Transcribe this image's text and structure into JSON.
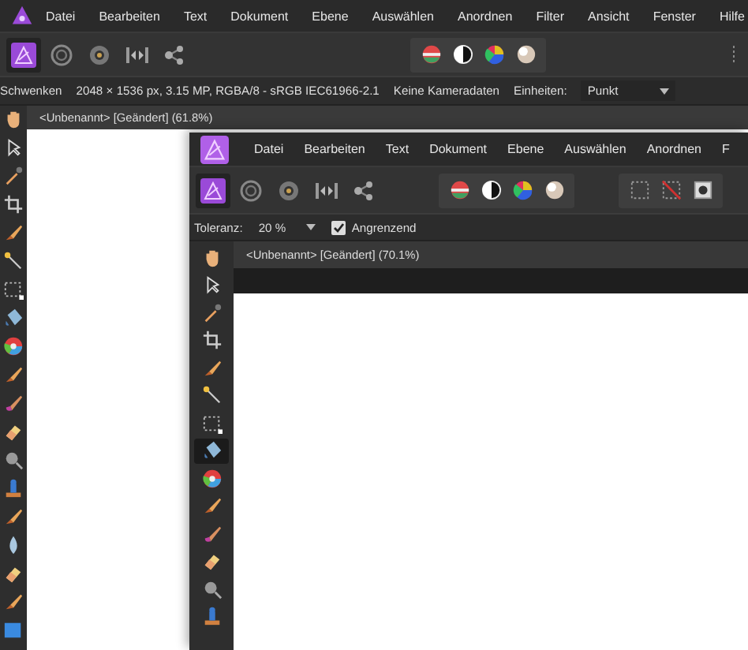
{
  "back_window": {
    "menu": [
      "Datei",
      "Bearbeiten",
      "Text",
      "Dokument",
      "Ebene",
      "Auswählen",
      "Anordnen",
      "Filter",
      "Ansicht",
      "Fenster",
      "Hilfe"
    ],
    "personas": [
      {
        "kind": "photo",
        "selected": true
      },
      {
        "kind": "liquify",
        "selected": false
      },
      {
        "kind": "develop",
        "selected": false
      },
      {
        "kind": "tonemap",
        "selected": false
      },
      {
        "kind": "export",
        "selected": false
      }
    ],
    "adjustments": [
      {
        "kind": "levels"
      },
      {
        "kind": "contrast"
      },
      {
        "kind": "hue"
      },
      {
        "kind": "white"
      }
    ],
    "context": {
      "tool": "Schwenken",
      "info": "2048 × 1536 px, 3.15 MP, RGBA/8 - sRGB IEC61966-2.1",
      "camera": "Keine Kameradaten",
      "units_label": "Einheiten:",
      "units_value": "Punkt"
    },
    "document_tab": "<Unbenannt> [Geändert] (61.8%)",
    "tools": [
      {
        "kind": "hand",
        "selected": false
      },
      {
        "kind": "pointer",
        "selected": false
      },
      {
        "kind": "eyedropper",
        "selected": false
      },
      {
        "kind": "crop",
        "selected": false
      },
      {
        "kind": "brush",
        "selected": false
      },
      {
        "kind": "wand",
        "selected": false
      },
      {
        "kind": "marquee",
        "selected": false
      },
      {
        "kind": "bucket",
        "selected": false
      },
      {
        "kind": "wheel",
        "selected": false
      },
      {
        "kind": "brush",
        "selected": false
      },
      {
        "kind": "mixer",
        "selected": false
      },
      {
        "kind": "eraser",
        "selected": false
      },
      {
        "kind": "dodge",
        "selected": false
      },
      {
        "kind": "stamp",
        "selected": false
      },
      {
        "kind": "brush",
        "selected": false
      },
      {
        "kind": "drop",
        "selected": false
      },
      {
        "kind": "eraser",
        "selected": false
      },
      {
        "kind": "brush",
        "selected": false
      },
      {
        "kind": "square",
        "selected": false
      }
    ]
  },
  "front_window": {
    "menu": [
      "Datei",
      "Bearbeiten",
      "Text",
      "Dokument",
      "Ebene",
      "Auswählen",
      "Anordnen",
      "F"
    ],
    "personas": [
      {
        "kind": "photo",
        "selected": true
      },
      {
        "kind": "liquify",
        "selected": false
      },
      {
        "kind": "develop",
        "selected": false
      },
      {
        "kind": "tonemap",
        "selected": false
      },
      {
        "kind": "export",
        "selected": false
      }
    ],
    "adjustments": [
      {
        "kind": "levels"
      },
      {
        "kind": "contrast"
      },
      {
        "kind": "hue"
      },
      {
        "kind": "white"
      }
    ],
    "selection_tools": [
      {
        "kind": "select-all"
      },
      {
        "kind": "deselect"
      },
      {
        "kind": "invert"
      }
    ],
    "context": {
      "tolerance_label": "Toleranz:",
      "tolerance_value": "20 %",
      "contiguous": {
        "label": "Angrenzend",
        "checked": true
      }
    },
    "document_tab": "<Unbenannt> [Geändert] (70.1%)",
    "tools": [
      {
        "kind": "hand",
        "selected": false
      },
      {
        "kind": "pointer",
        "selected": false
      },
      {
        "kind": "eyedropper",
        "selected": false
      },
      {
        "kind": "crop",
        "selected": false
      },
      {
        "kind": "brush",
        "selected": false
      },
      {
        "kind": "wand",
        "selected": false
      },
      {
        "kind": "marquee",
        "selected": false
      },
      {
        "kind": "bucket",
        "selected": true
      },
      {
        "kind": "wheel",
        "selected": false
      },
      {
        "kind": "brush",
        "selected": false
      },
      {
        "kind": "mixer",
        "selected": false
      },
      {
        "kind": "eraser",
        "selected": false
      },
      {
        "kind": "dodge",
        "selected": false
      },
      {
        "kind": "stamp",
        "selected": false
      }
    ]
  }
}
